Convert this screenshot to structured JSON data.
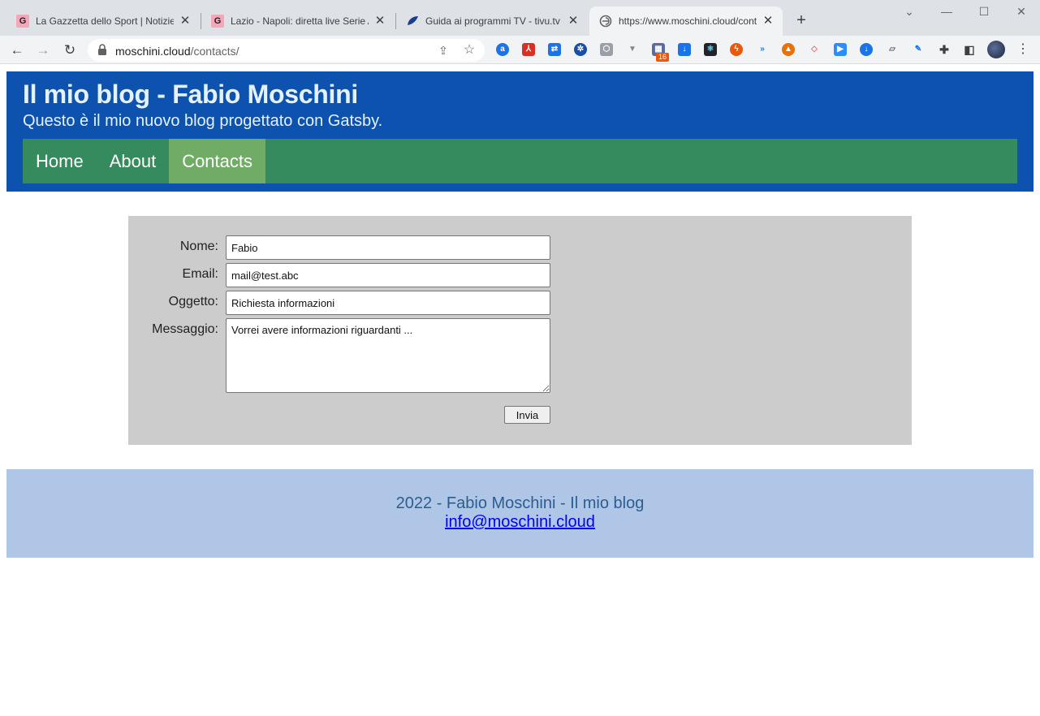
{
  "browser": {
    "tabs": [
      {
        "title": "La Gazzetta dello Sport | Notizie",
        "favicon": "G",
        "favicon_color": "#f5a6b8"
      },
      {
        "title": "Lazio - Napoli: diretta live Serie A",
        "favicon": "G",
        "favicon_color": "#f5a6b8"
      },
      {
        "title": "Guida ai programmi TV - tivu.tv",
        "favicon": "",
        "favicon_color": "#1a3d8f"
      },
      {
        "title": "https://www.moschini.cloud/cont",
        "favicon": "",
        "favicon_color": "#5f6368"
      }
    ],
    "active_tab": 3,
    "url_host": "moschini.cloud",
    "url_path": "/contacts/",
    "extension_badge": "16"
  },
  "site": {
    "title": "Il mio blog - Fabio Moschini",
    "subtitle": "Questo è il mio nuovo blog progettato con Gatsby.",
    "nav": [
      {
        "label": "Home",
        "active": false
      },
      {
        "label": "About",
        "active": false
      },
      {
        "label": "Contacts",
        "active": true
      }
    ]
  },
  "form": {
    "name_label": "Nome:",
    "name_value": "Fabio",
    "email_label": "Email:",
    "email_value": "mail@test.abc",
    "subject_label": "Oggetto:",
    "subject_value": "Richiesta informazioni",
    "message_label": "Messaggio:",
    "message_value": "Vorrei avere informazioni riguardanti ...",
    "submit_label": "Invia"
  },
  "footer": {
    "text": "2022 - Fabio Moschini - Il mio blog",
    "email": "info@moschini.cloud"
  },
  "colors": {
    "header_bg": "#0e52af",
    "nav_bg": "#358b5d",
    "nav_active_bg": "#71ac66",
    "form_bg": "#cccccc",
    "footer_bg": "#b0c6e6"
  }
}
